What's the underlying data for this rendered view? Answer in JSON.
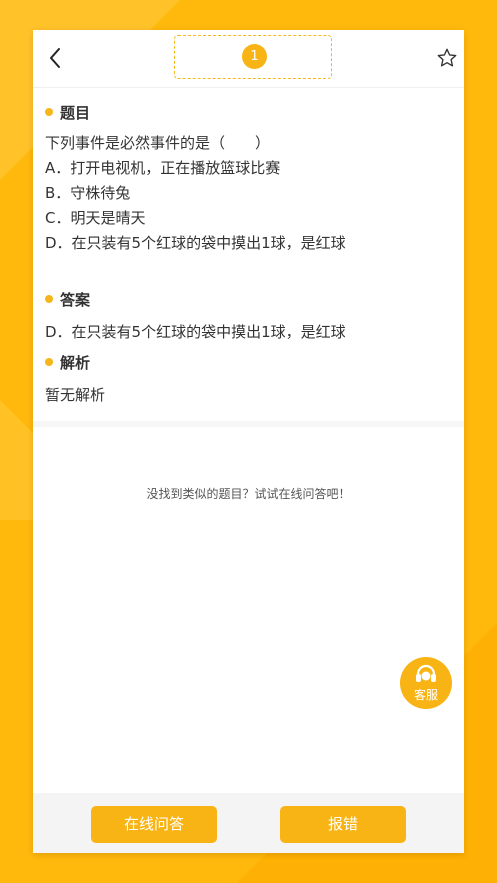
{
  "header": {
    "page_number": "1",
    "back_icon": "chevron-left-icon",
    "favorite_icon": "star-icon"
  },
  "question": {
    "heading": "题目",
    "stem": "下列事件是必然事件的是（　　）",
    "options": [
      "A．打开电视机，正在播放篮球比赛",
      "B．守株待兔",
      "C．明天是晴天",
      "D．在只装有5个红球的袋中摸出1球，是红球"
    ]
  },
  "answer": {
    "heading": "答案",
    "text": "D．在只装有5个红球的袋中摸出1球，是红球"
  },
  "analysis": {
    "heading": "解析",
    "text": "暂无解析"
  },
  "hint": "没找到类似的题目？试试在线问答吧！",
  "service": {
    "label": "客服",
    "icon": "headset-icon"
  },
  "bottom": {
    "ask_label": "在线问答",
    "report_label": "报错"
  },
  "colors": {
    "accent": "#f8b414",
    "background": "#ffb80c"
  }
}
